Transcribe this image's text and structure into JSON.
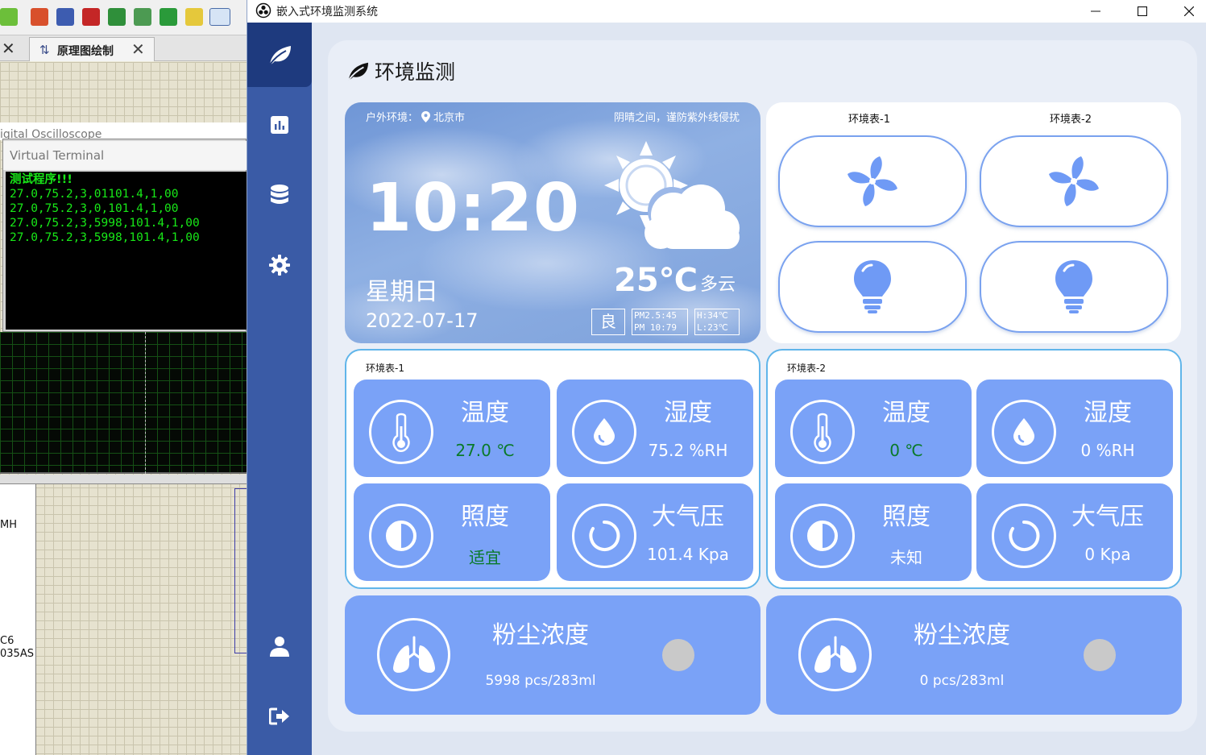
{
  "background_ide": {
    "tab_label": "原理图绘制",
    "scope_title": "igital Oscilloscope",
    "terminal_title": "Virtual Terminal",
    "terminal_lines": [
      "测试程序!!!",
      "27.0,75.2,3,01101.4,1,00",
      "27.0,75.2,3,0,101.4,1,00",
      "27.0,75.2,3,5998,101.4,1,00",
      "27.0,75.2,3,5998,101.4,1,00"
    ],
    "side_text_1": "MH",
    "side_text_2": "C6",
    "side_text_3": "035AS"
  },
  "window": {
    "title": "嵌入式环境监测系统"
  },
  "sidebar": {
    "items": [
      {
        "icon": "leaf-icon",
        "active": true
      },
      {
        "icon": "bar-chart-icon"
      },
      {
        "icon": "database-icon"
      },
      {
        "icon": "gear-icon"
      },
      {
        "icon": "user-icon"
      },
      {
        "icon": "logout-icon"
      }
    ]
  },
  "page": {
    "title": "环境监测"
  },
  "weather": {
    "location_label": "户外环境：",
    "city": "北京市",
    "tip": "阴晴之间，谨防紫外线侵扰",
    "time": "10:20",
    "weekday": "星期日",
    "date": "2022-07-17",
    "temperature": "25℃",
    "condition": "多云",
    "aqi": "良",
    "pm25": "PM2.5:45",
    "pm10": "PM 10:79",
    "high": "H:34℃",
    "low": "L:23℃"
  },
  "controls": {
    "col1_title": "环境表-1",
    "col2_title": "环境表-2"
  },
  "panels": [
    {
      "title": "环境表-1",
      "temp_label": "温度",
      "temp_value": "27.0 ℃",
      "humid_label": "湿度",
      "humid_value": "75.2 %RH",
      "light_label": "照度",
      "light_value": "适宜",
      "press_label": "大气压",
      "press_value": "101.4 Kpa"
    },
    {
      "title": "环境表-2",
      "temp_label": "温度",
      "temp_value": "0 ℃",
      "humid_label": "湿度",
      "humid_value": "0 %RH",
      "light_label": "照度",
      "light_value": "未知",
      "press_label": "大气压",
      "press_value": "0 Kpa"
    }
  ],
  "dust": [
    {
      "label": "粉尘浓度",
      "value": "5998 pcs/283ml"
    },
    {
      "label": "粉尘浓度",
      "value": "0 pcs/283ml"
    }
  ],
  "colors": {
    "sidebar": "#3a5ba6",
    "tile": "#7aa2f7",
    "panel_border": "#60b5ea",
    "ok_green": "#0a7a2a"
  }
}
